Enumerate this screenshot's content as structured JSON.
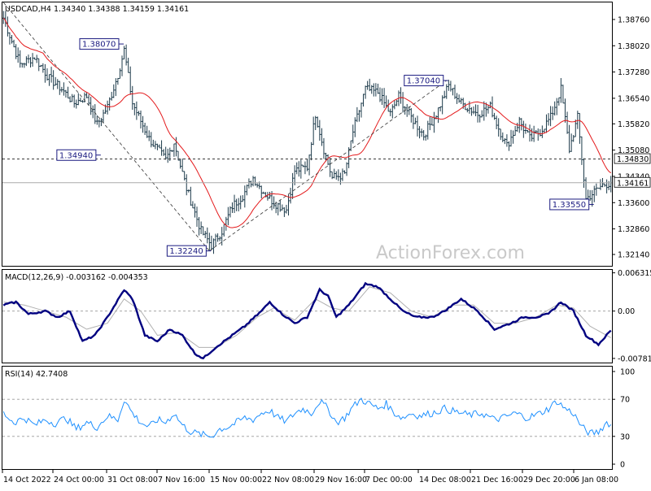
{
  "chart_data": [
    {
      "panel": "price",
      "type": "ohlc",
      "header": "USDCAD,H4  1.34340 1.34388 1.34159 1.34161",
      "ylim": [
        1.3182,
        1.3924
      ],
      "y_ticks": [
        "1.38760",
        "1.38020",
        "1.37280",
        "1.36540",
        "1.35820",
        "1.35080",
        "1.34340",
        "1.33600",
        "1.32860",
        "1.32140"
      ],
      "ma_color": "#e41a1c",
      "bar_color": "#1c3a4a",
      "close_keypoints": [
        [
          0,
          1.388
        ],
        [
          8,
          1.375
        ],
        [
          15,
          1.377
        ],
        [
          22,
          1.371
        ],
        [
          28,
          1.368
        ],
        [
          34,
          1.364
        ],
        [
          40,
          1.366
        ],
        [
          45,
          1.358
        ],
        [
          50,
          1.363
        ],
        [
          55,
          1.372
        ],
        [
          58,
          1.379
        ],
        [
          62,
          1.364
        ],
        [
          70,
          1.354
        ],
        [
          78,
          1.348
        ],
        [
          82,
          1.353
        ],
        [
          88,
          1.34
        ],
        [
          95,
          1.328
        ],
        [
          100,
          1.324
        ],
        [
          105,
          1.328
        ],
        [
          110,
          1.335
        ],
        [
          115,
          1.338
        ],
        [
          120,
          1.343
        ],
        [
          125,
          1.339
        ],
        [
          130,
          1.336
        ],
        [
          136,
          1.334
        ],
        [
          140,
          1.345
        ],
        [
          146,
          1.346
        ],
        [
          150,
          1.361
        ],
        [
          154,
          1.351
        ],
        [
          158,
          1.343
        ],
        [
          164,
          1.344
        ],
        [
          168,
          1.356
        ],
        [
          174,
          1.368
        ],
        [
          180,
          1.367
        ],
        [
          186,
          1.361
        ],
        [
          190,
          1.366
        ],
        [
          196,
          1.36
        ],
        [
          202,
          1.355
        ],
        [
          208,
          1.361
        ],
        [
          214,
          1.369
        ],
        [
          220,
          1.364
        ],
        [
          228,
          1.361
        ],
        [
          234,
          1.363
        ],
        [
          238,
          1.357
        ],
        [
          242,
          1.352
        ],
        [
          248,
          1.359
        ],
        [
          253,
          1.354
        ],
        [
          258,
          1.356
        ],
        [
          263,
          1.36
        ],
        [
          268,
          1.368
        ],
        [
          272,
          1.351
        ],
        [
          276,
          1.36
        ],
        [
          280,
          1.337
        ],
        [
          284,
          1.339
        ],
        [
          288,
          1.341
        ],
        [
          292,
          1.3416
        ]
      ],
      "annotations": [
        {
          "label": "1.38070",
          "bar": 57,
          "price": 1.3807,
          "side": "left"
        },
        {
          "label": "1.34940",
          "bar": 46,
          "price": 1.3494,
          "side": "left"
        },
        {
          "label": "1.32240",
          "bar": 99,
          "price": 1.3224,
          "side": "left"
        },
        {
          "label": "1.37040",
          "bar": 213,
          "price": 1.3704,
          "side": "left"
        },
        {
          "label": "1.33550",
          "bar": 283,
          "price": 1.3355,
          "side": "left"
        }
      ],
      "hline_dashed": {
        "value": 1.3483,
        "label": "1.34830"
      },
      "hline_current": {
        "value": 1.34161,
        "label": "1.34161"
      },
      "trendlines": [
        {
          "from": [
            0,
            1.3924
          ],
          "to": [
            99,
            1.3224
          ]
        },
        {
          "from": [
            99,
            1.3224
          ],
          "to": [
            213,
            1.3704
          ]
        }
      ]
    },
    {
      "panel": "macd",
      "type": "line",
      "header": "MACD(12,26,9) -0.003162 -0.004353",
      "ylim": [
        -0.0085,
        0.0068
      ],
      "y_ticks": [
        "0.006315",
        "0.00",
        "-0.007818"
      ],
      "series": [
        {
          "name": "MACD",
          "color": "#000080",
          "keypoints": [
            [
              0,
              0.001
            ],
            [
              6,
              0.0015
            ],
            [
              12,
              -0.0005
            ],
            [
              20,
              0.0
            ],
            [
              26,
              -0.001
            ],
            [
              32,
              0.0
            ],
            [
              38,
              -0.005
            ],
            [
              44,
              -0.004
            ],
            [
              50,
              -0.001
            ],
            [
              58,
              0.0035
            ],
            [
              62,
              0.002
            ],
            [
              68,
              -0.004
            ],
            [
              74,
              -0.005
            ],
            [
              80,
              -0.003
            ],
            [
              86,
              -0.004
            ],
            [
              92,
              -0.007
            ],
            [
              96,
              -0.0078
            ],
            [
              102,
              -0.006
            ],
            [
              108,
              -0.0045
            ],
            [
              116,
              -0.0025
            ],
            [
              124,
              0.0
            ],
            [
              128,
              0.0015
            ],
            [
              134,
              -0.0005
            ],
            [
              140,
              -0.002
            ],
            [
              146,
              -0.001
            ],
            [
              152,
              0.0035
            ],
            [
              156,
              0.0025
            ],
            [
              160,
              -0.001
            ],
            [
              166,
              0.001
            ],
            [
              174,
              0.0045
            ],
            [
              180,
              0.004
            ],
            [
              186,
              0.002
            ],
            [
              192,
              0.0
            ],
            [
              198,
              -0.001
            ],
            [
              206,
              -0.001
            ],
            [
              212,
              0.0
            ],
            [
              220,
              0.002
            ],
            [
              228,
              0.0
            ],
            [
              236,
              -0.003
            ],
            [
              244,
              -0.002
            ],
            [
              250,
              -0.001
            ],
            [
              256,
              -0.001
            ],
            [
              262,
              -0.0005
            ],
            [
              268,
              0.0015
            ],
            [
              274,
              0.0
            ],
            [
              280,
              -0.004
            ],
            [
              286,
              -0.0055
            ],
            [
              292,
              -0.0032
            ]
          ]
        },
        {
          "name": "Signal",
          "color": "#b0b0b0",
          "keypoints": [
            [
              0,
              0.0015
            ],
            [
              10,
              0.001
            ],
            [
              20,
              0.0
            ],
            [
              30,
              -0.001
            ],
            [
              40,
              -0.003
            ],
            [
              50,
              -0.002
            ],
            [
              58,
              0.002
            ],
            [
              66,
              0.0
            ],
            [
              74,
              -0.004
            ],
            [
              84,
              -0.0035
            ],
            [
              94,
              -0.006
            ],
            [
              102,
              -0.006
            ],
            [
              112,
              -0.004
            ],
            [
              122,
              -0.001
            ],
            [
              130,
              0.0005
            ],
            [
              140,
              -0.0015
            ],
            [
              150,
              0.002
            ],
            [
              158,
              0.0005
            ],
            [
              166,
              0.0
            ],
            [
              176,
              0.004
            ],
            [
              186,
              0.003
            ],
            [
              196,
              0.0
            ],
            [
              206,
              -0.001
            ],
            [
              216,
              0.001
            ],
            [
              226,
              0.001
            ],
            [
              236,
              -0.002
            ],
            [
              246,
              -0.002
            ],
            [
              256,
              -0.001
            ],
            [
              266,
              0.001
            ],
            [
              274,
              0.0005
            ],
            [
              282,
              -0.0025
            ],
            [
              292,
              -0.0044
            ]
          ]
        }
      ]
    },
    {
      "panel": "rsi",
      "type": "line",
      "header": "RSI(14) 42.7408",
      "ylim": [
        0,
        100
      ],
      "y_ticks": [
        "100",
        "70",
        "30",
        "0"
      ],
      "levels": [
        70,
        30
      ],
      "series": [
        {
          "name": "RSI",
          "color": "#1e90ff",
          "keypoints": [
            [
              0,
              55
            ],
            [
              5,
              45
            ],
            [
              10,
              50
            ],
            [
              15,
              42
            ],
            [
              20,
              48
            ],
            [
              25,
              44
            ],
            [
              30,
              50
            ],
            [
              35,
              38
            ],
            [
              40,
              45
            ],
            [
              45,
              40
            ],
            [
              50,
              52
            ],
            [
              55,
              48
            ],
            [
              58,
              70
            ],
            [
              62,
              55
            ],
            [
              66,
              45
            ],
            [
              70,
              40
            ],
            [
              74,
              48
            ],
            [
              78,
              45
            ],
            [
              82,
              55
            ],
            [
              86,
              42
            ],
            [
              90,
              35
            ],
            [
              95,
              32
            ],
            [
              100,
              30
            ],
            [
              104,
              38
            ],
            [
              108,
              40
            ],
            [
              112,
              45
            ],
            [
              116,
              50
            ],
            [
              120,
              48
            ],
            [
              124,
              55
            ],
            [
              128,
              58
            ],
            [
              132,
              50
            ],
            [
              136,
              46
            ],
            [
              140,
              55
            ],
            [
              144,
              60
            ],
            [
              148,
              55
            ],
            [
              152,
              68
            ],
            [
              156,
              60
            ],
            [
              160,
              45
            ],
            [
              164,
              50
            ],
            [
              168,
              62
            ],
            [
              172,
              70
            ],
            [
              176,
              65
            ],
            [
              180,
              60
            ],
            [
              184,
              65
            ],
            [
              188,
              55
            ],
            [
              192,
              50
            ],
            [
              196,
              55
            ],
            [
              200,
              52
            ],
            [
              206,
              55
            ],
            [
              212,
              60
            ],
            [
              218,
              56
            ],
            [
              224,
              53
            ],
            [
              230,
              55
            ],
            [
              236,
              48
            ],
            [
              240,
              50
            ],
            [
              246,
              55
            ],
            [
              252,
              50
            ],
            [
              258,
              55
            ],
            [
              262,
              60
            ],
            [
              266,
              68
            ],
            [
              270,
              60
            ],
            [
              274,
              55
            ],
            [
              278,
              40
            ],
            [
              282,
              33
            ],
            [
              286,
              35
            ],
            [
              290,
              45
            ],
            [
              292,
              42.7
            ]
          ]
        }
      ]
    }
  ],
  "x_axis": {
    "labels": [
      "14 Oct 2022",
      "24 Oct 00:00",
      "31 Oct 08:00",
      "7 Nov 16:00",
      "15 Nov 00:00",
      "22 Nov 08:00",
      "29 Nov 16:00",
      "7 Dec 00:00",
      "14 Dec 08:00",
      "21 Dec 16:00",
      "29 Dec 20:00",
      "6 Jan 08:00"
    ]
  },
  "watermark": "ActionForex.com"
}
